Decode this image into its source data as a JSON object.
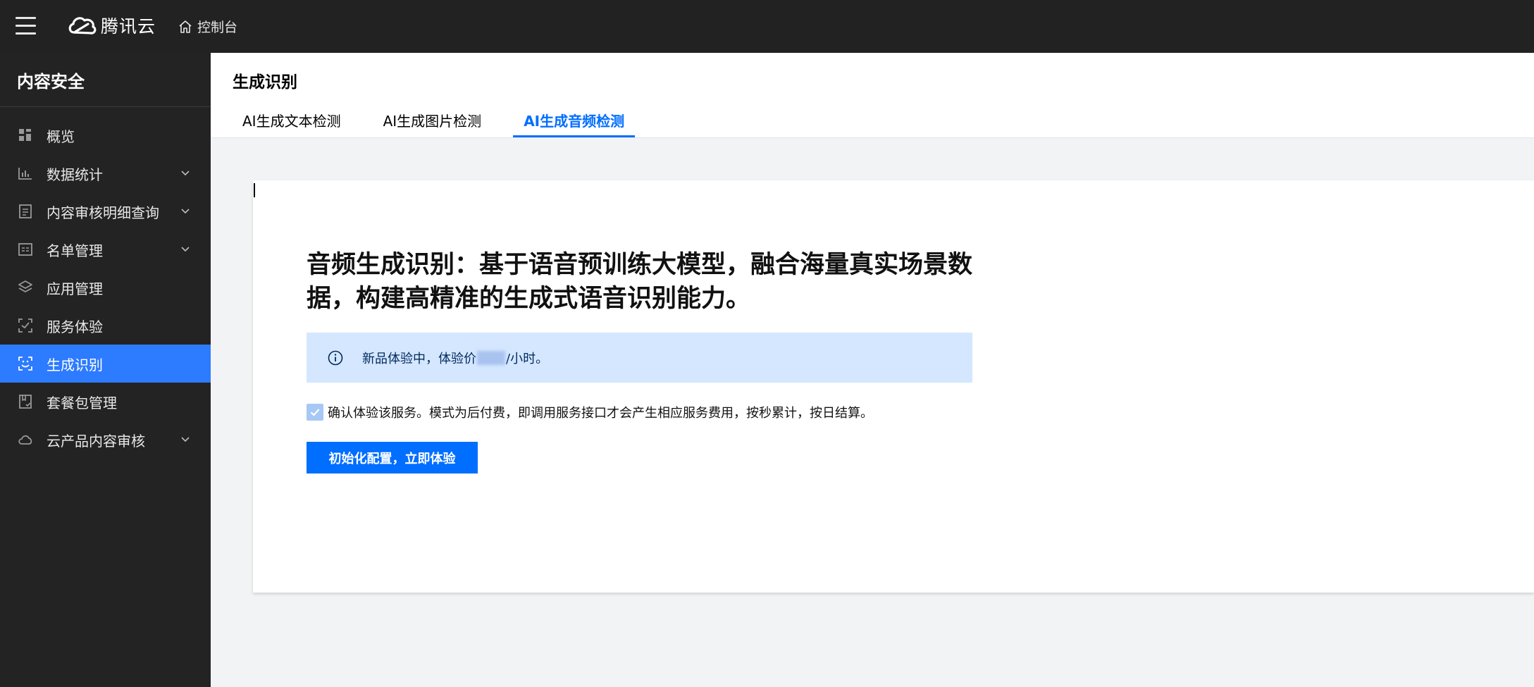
{
  "topbar": {
    "brand": "腾讯云",
    "console_label": "控制台"
  },
  "sidebar": {
    "title": "内容安全",
    "items": [
      {
        "label": "概览",
        "icon": "grid-icon",
        "has_chevron": false,
        "active": false
      },
      {
        "label": "数据统计",
        "icon": "bar-chart-icon",
        "has_chevron": true,
        "active": false
      },
      {
        "label": "内容审核明细查询",
        "icon": "document-list-icon",
        "has_chevron": true,
        "active": false
      },
      {
        "label": "名单管理",
        "icon": "list-box-icon",
        "has_chevron": true,
        "active": false
      },
      {
        "label": "应用管理",
        "icon": "layers-icon",
        "has_chevron": false,
        "active": false
      },
      {
        "label": "服务体验",
        "icon": "scan-check-icon",
        "has_chevron": false,
        "active": false
      },
      {
        "label": "生成识别",
        "icon": "scan-face-icon",
        "has_chevron": false,
        "active": true
      },
      {
        "label": "套餐包管理",
        "icon": "package-icon",
        "has_chevron": false,
        "active": false
      },
      {
        "label": "云产品内容审核",
        "icon": "cloud-icon",
        "has_chevron": true,
        "active": false
      }
    ]
  },
  "main": {
    "title": "生成识别",
    "tabs": [
      {
        "label": "AI生成文本检测",
        "active": false
      },
      {
        "label": "AI生成图片检测",
        "active": false
      },
      {
        "label": "AI生成音频检测",
        "active": true
      }
    ],
    "headline": "音频生成识别：基于语音预训练大模型，融合海量真实场景数据，构建高精准的生成式语音识别能力。",
    "notice_prefix": "新品体验中，体验价",
    "notice_suffix": "/小时。",
    "confirm_text": "确认体验该服务。模式为后付费，即调用服务接口才会产生相应服务费用，按秒累计，按日结算。",
    "confirm_checked": true,
    "init_button": "初始化配置，立即体验"
  },
  "colors": {
    "topbar": "#222222",
    "sidebar": "#232323",
    "accent": "#006eff",
    "active_nav": "#2d7bff",
    "notice_bg": "#d5e7ff"
  }
}
